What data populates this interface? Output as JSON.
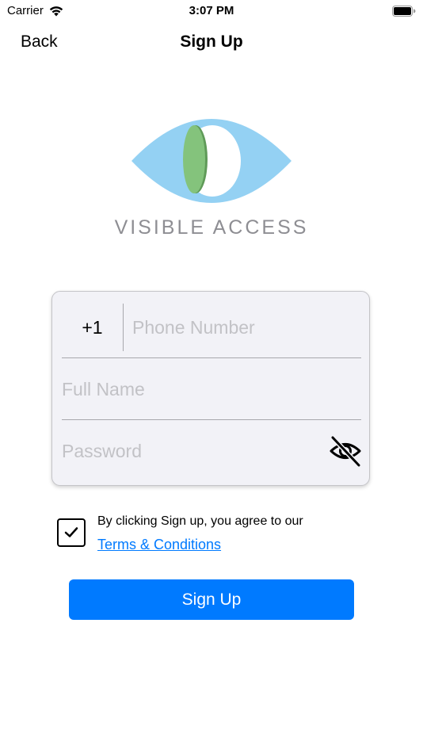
{
  "status_bar": {
    "carrier": "Carrier",
    "time": "3:07 PM",
    "icons": [
      "wifi-icon",
      "battery-icon"
    ]
  },
  "nav": {
    "back_label": "Back",
    "title": "Sign Up"
  },
  "brand": {
    "name": "VISIBLE ACCESS",
    "logo_icon": "eye-logo"
  },
  "form": {
    "country_code": "+1",
    "phone_placeholder": "Phone Number",
    "name_placeholder": "Full Name",
    "password_placeholder": "Password",
    "password_toggle_icon": "eye-slash-icon"
  },
  "terms": {
    "checked": true,
    "text": "By clicking Sign up, you agree to our",
    "link_label": "Terms & Conditions"
  },
  "signup_label": "Sign Up",
  "colors": {
    "accent": "#007aff",
    "logo_light_blue": "#94d1f3",
    "logo_green": "#84c37c",
    "card_background": "#f2f2f7",
    "placeholder": "#c2c2c6",
    "brand_text": "#8e8e93"
  }
}
